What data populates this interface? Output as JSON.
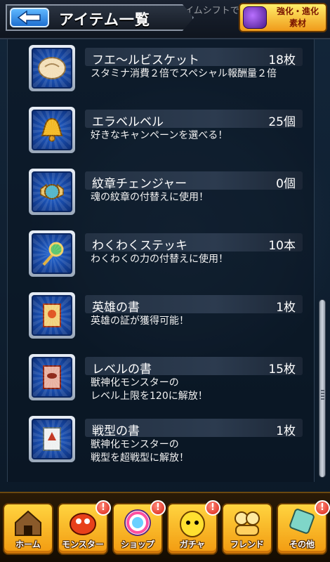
{
  "header": {
    "title": "アイテム一覧",
    "marquee": "タイムシフトで好きなクエストを",
    "evo_badge": "強化・進化\n素材",
    "back_icon": "back-arrow-icon"
  },
  "items": [
    {
      "name": "フエ～ルビスケット",
      "count": "18枚",
      "desc": "スタミナ消費２倍でスペシャル報酬量２倍",
      "icon": "biscuit-icon"
    },
    {
      "name": "エラベルベル",
      "count": "25個",
      "desc": "好きなキャンペーンを選べる！",
      "icon": "bell-icon"
    },
    {
      "name": "紋章チェンジャー",
      "count": "0個",
      "desc": "魂の紋章の付替えに使用！",
      "icon": "emblem-changer-icon"
    },
    {
      "name": "わくわくステッキ",
      "count": "10本",
      "desc": "わくわくの力の付替えに使用！",
      "icon": "wand-icon"
    },
    {
      "name": "英雄の書",
      "count": "1枚",
      "desc": "英雄の証が獲得可能！",
      "icon": "hero-scroll-icon"
    },
    {
      "name": "レベルの書",
      "count": "15枚",
      "desc": "獣神化モンスターの\nレベル上限を120に解放！",
      "icon": "level-scroll-icon"
    },
    {
      "name": "戦型の書",
      "count": "1枚",
      "desc": "獣神化モンスターの\n戦型を超戦型に解放！",
      "icon": "battle-type-scroll-icon"
    }
  ],
  "nav": [
    {
      "label": "ホーム",
      "icon": "home-icon",
      "badge": ""
    },
    {
      "label": "モンスター",
      "icon": "monster-icon",
      "badge": "!"
    },
    {
      "label": "ショップ",
      "icon": "shop-orb-icon",
      "badge": "!"
    },
    {
      "label": "ガチャ",
      "icon": "gacha-icon",
      "badge": "!"
    },
    {
      "label": "フレンド",
      "icon": "friend-icon",
      "badge": ""
    },
    {
      "label": "その他",
      "icon": "other-icon",
      "badge": "!"
    }
  ],
  "colors": {
    "accent": "#f29a10",
    "back_button": "#1e6fd0",
    "icon_bg": "#1a4fb0"
  }
}
